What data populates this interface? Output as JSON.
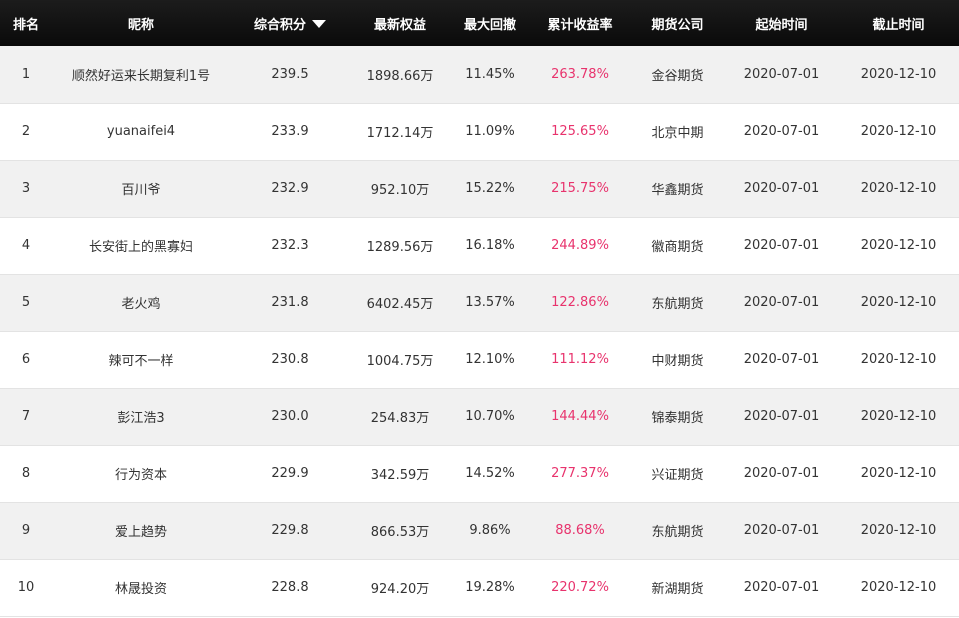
{
  "headers": {
    "rank": "排名",
    "nickname": "昵称",
    "score": "综合积分",
    "equity": "最新权益",
    "drawdown": "最大回撤",
    "return": "累计收益率",
    "company": "期货公司",
    "start": "起始时间",
    "end": "截止时间"
  },
  "colors": {
    "header_bg": "#111111",
    "return_text": "#e8336d",
    "row_alt": "#f1f1f1"
  },
  "sort_icon": "triangle-down-icon",
  "rows": [
    {
      "rank": "1",
      "nickname": "顺然好运来长期复利1号",
      "score": "239.5",
      "equity": "1898.66万",
      "drawdown": "11.45%",
      "return": "263.78%",
      "company": "金谷期货",
      "start": "2020-07-01",
      "end": "2020-12-10"
    },
    {
      "rank": "2",
      "nickname": "yuanaifei4",
      "score": "233.9",
      "equity": "1712.14万",
      "drawdown": "11.09%",
      "return": "125.65%",
      "company": "北京中期",
      "start": "2020-07-01",
      "end": "2020-12-10"
    },
    {
      "rank": "3",
      "nickname": "百川爷",
      "score": "232.9",
      "equity": "952.10万",
      "drawdown": "15.22%",
      "return": "215.75%",
      "company": "华鑫期货",
      "start": "2020-07-01",
      "end": "2020-12-10"
    },
    {
      "rank": "4",
      "nickname": "长安街上的黑寡妇",
      "score": "232.3",
      "equity": "1289.56万",
      "drawdown": "16.18%",
      "return": "244.89%",
      "company": "徽商期货",
      "start": "2020-07-01",
      "end": "2020-12-10"
    },
    {
      "rank": "5",
      "nickname": "老火鸡",
      "score": "231.8",
      "equity": "6402.45万",
      "drawdown": "13.57%",
      "return": "122.86%",
      "company": "东航期货",
      "start": "2020-07-01",
      "end": "2020-12-10"
    },
    {
      "rank": "6",
      "nickname": "辣可不一样",
      "score": "230.8",
      "equity": "1004.75万",
      "drawdown": "12.10%",
      "return": "111.12%",
      "company": "中财期货",
      "start": "2020-07-01",
      "end": "2020-12-10"
    },
    {
      "rank": "7",
      "nickname": "彭江浩3",
      "score": "230.0",
      "equity": "254.83万",
      "drawdown": "10.70%",
      "return": "144.44%",
      "company": "锦泰期货",
      "start": "2020-07-01",
      "end": "2020-12-10"
    },
    {
      "rank": "8",
      "nickname": "行为资本",
      "score": "229.9",
      "equity": "342.59万",
      "drawdown": "14.52%",
      "return": "277.37%",
      "company": "兴证期货",
      "start": "2020-07-01",
      "end": "2020-12-10"
    },
    {
      "rank": "9",
      "nickname": "爱上趋势",
      "score": "229.8",
      "equity": "866.53万",
      "drawdown": "9.86%",
      "return": "88.68%",
      "company": "东航期货",
      "start": "2020-07-01",
      "end": "2020-12-10"
    },
    {
      "rank": "10",
      "nickname": "林晟投资",
      "score": "228.8",
      "equity": "924.20万",
      "drawdown": "19.28%",
      "return": "220.72%",
      "company": "新湖期货",
      "start": "2020-07-01",
      "end": "2020-12-10"
    }
  ]
}
